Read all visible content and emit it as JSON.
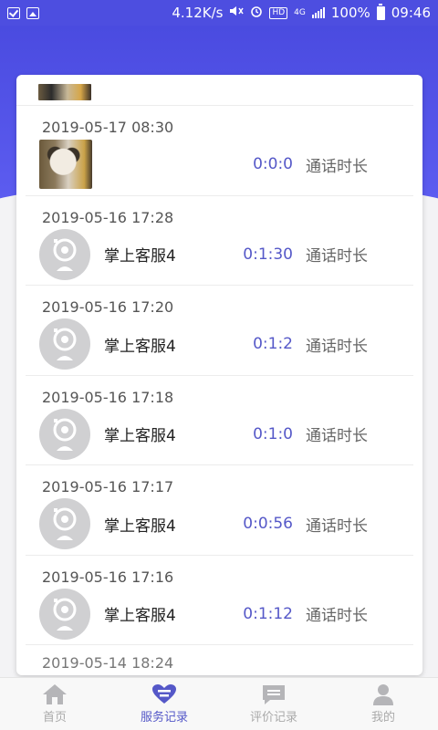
{
  "status_bar": {
    "speed": "4.12K/s",
    "hd": "HD",
    "network": "4G",
    "battery": "100%",
    "time": "09:46"
  },
  "colors": {
    "accent": "#5558c8",
    "header": "#4d4ee0"
  },
  "records": [
    {
      "time": "2019-05-17 08:30",
      "agent": "",
      "duration": "0:0:0",
      "duration_label": "通话时长",
      "avatar": "photo"
    },
    {
      "time": "2019-05-16 17:28",
      "agent": "掌上客服4",
      "duration": "0:1:30",
      "duration_label": "通话时长",
      "avatar": "default"
    },
    {
      "time": "2019-05-16 17:20",
      "agent": "掌上客服4",
      "duration": "0:1:2",
      "duration_label": "通话时长",
      "avatar": "default"
    },
    {
      "time": "2019-05-16 17:18",
      "agent": "掌上客服4",
      "duration": "0:1:0",
      "duration_label": "通话时长",
      "avatar": "default"
    },
    {
      "time": "2019-05-16 17:17",
      "agent": "掌上客服4",
      "duration": "0:0:56",
      "duration_label": "通话时长",
      "avatar": "default"
    },
    {
      "time": "2019-05-16 17:16",
      "agent": "掌上客服4",
      "duration": "0:1:12",
      "duration_label": "通话时长",
      "avatar": "default"
    }
  ],
  "partial_bottom_time": "2019-05-14 18:24",
  "nav": {
    "home": "首页",
    "service": "服务记录",
    "review": "评价记录",
    "mine": "我的"
  }
}
